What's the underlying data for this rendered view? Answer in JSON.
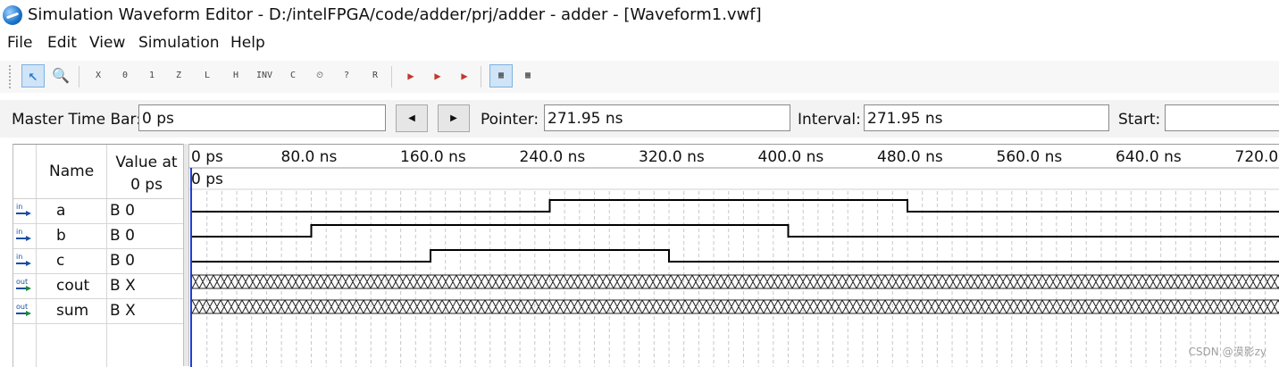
{
  "window": {
    "title": "Simulation Waveform Editor - D:/intelFPGA/code/adder/prj/adder - adder - [Waveform1.vwf]",
    "icon": "quartus-simulation-icon"
  },
  "menu": [
    "File",
    "Edit",
    "View",
    "Simulation",
    "Help"
  ],
  "toolbar": {
    "tools": [
      {
        "name": "selection-tool-icon",
        "glyph": "↖",
        "active": true
      },
      {
        "name": "zoom-tool-icon",
        "glyph": "🔍",
        "active": false
      },
      {
        "name": "forcing-unknown-icon",
        "glyph": "X",
        "active": false
      },
      {
        "name": "forcing-low-icon",
        "glyph": "0",
        "active": false
      },
      {
        "name": "forcing-high-icon",
        "glyph": "1",
        "active": false
      },
      {
        "name": "high-impedance-icon",
        "glyph": "Z",
        "active": false
      },
      {
        "name": "weak-low-icon",
        "glyph": "L",
        "active": false
      },
      {
        "name": "weak-high-icon",
        "glyph": "H",
        "active": false
      },
      {
        "name": "invert-icon",
        "glyph": "INV",
        "active": false
      },
      {
        "name": "count-value-icon",
        "glyph": "C",
        "active": false
      },
      {
        "name": "clock-icon",
        "glyph": "⏲",
        "active": false
      },
      {
        "name": "arbitrary-value-icon",
        "glyph": "?",
        "active": false
      },
      {
        "name": "random-value-icon",
        "glyph": "R",
        "active": false
      },
      {
        "name": "run-functional-simulation-icon",
        "glyph": "▶",
        "active": false
      },
      {
        "name": "run-timing-simulation-icon",
        "glyph": "▶",
        "active": false
      },
      {
        "name": "generate-netlist-icon",
        "glyph": "▶",
        "active": false
      },
      {
        "name": "snap-to-grid-icon",
        "glyph": "▦",
        "active": true
      },
      {
        "name": "grid-icon",
        "glyph": "▦",
        "active": false
      }
    ]
  },
  "timebar": {
    "master_label": "Master Time Bar:",
    "master_value": "0 ps",
    "prev_glyph": "◀",
    "next_glyph": "▶",
    "pointer_label": "Pointer:",
    "pointer_value": "271.95 ns",
    "interval_label": "Interval:",
    "interval_value": "271.95 ns",
    "start_label": "Start:",
    "start_value": ""
  },
  "signal_list": {
    "header_name": "Name",
    "header_value": "Value at 0 ps",
    "header_value_line1": "Value at",
    "header_value_line2": "0 ps",
    "signals": [
      {
        "name": "a",
        "direction": "in",
        "value": "B 0"
      },
      {
        "name": "b",
        "direction": "in",
        "value": "B 0"
      },
      {
        "name": "c",
        "direction": "in",
        "value": "B 0"
      },
      {
        "name": "cout",
        "direction": "out",
        "value": "B X"
      },
      {
        "name": "sum",
        "direction": "out",
        "value": "B X"
      }
    ]
  },
  "waveform": {
    "ruler_labels": [
      "0 ps",
      "80.0 ns",
      "160.0 ns",
      "240.0 ns",
      "320.0 ns",
      "400.0 ns",
      "480.0 ns",
      "560.0 ns",
      "640.0 ns",
      "720.0"
    ],
    "cursor_label": "0 ps",
    "time_unit": "ns",
    "waves": [
      {
        "name": "a",
        "kind": "binary",
        "transitions": [
          {
            "t": 0,
            "v": 0
          },
          {
            "t": 240,
            "v": 1
          },
          {
            "t": 480,
            "v": 0
          }
        ]
      },
      {
        "name": "b",
        "kind": "binary",
        "transitions": [
          {
            "t": 0,
            "v": 0
          },
          {
            "t": 80,
            "v": 1
          },
          {
            "t": 400,
            "v": 0
          }
        ]
      },
      {
        "name": "c",
        "kind": "binary",
        "transitions": [
          {
            "t": 0,
            "v": 0
          },
          {
            "t": 160,
            "v": 1
          },
          {
            "t": 320,
            "v": 0
          }
        ]
      },
      {
        "name": "cout",
        "kind": "unknown"
      },
      {
        "name": "sum",
        "kind": "unknown"
      }
    ]
  },
  "watermark": "CSDN @漠影zy"
}
